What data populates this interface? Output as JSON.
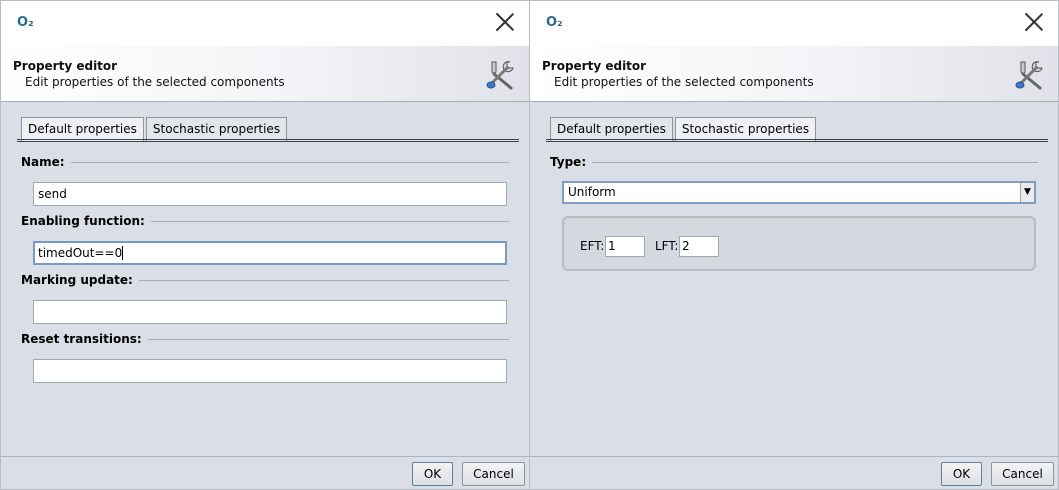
{
  "window": {
    "app_logo": "O₂"
  },
  "header": {
    "title": "Property editor",
    "subtitle": "Edit properties of the selected components",
    "icon": "tools-icon"
  },
  "tabs": [
    "Default properties",
    "Stochastic properties"
  ],
  "left_dialog": {
    "active_tab": "Default properties",
    "fields": [
      {
        "label": "Name:",
        "value": "send"
      },
      {
        "label": "Enabling function:",
        "value": "timedOut==0"
      },
      {
        "label": "Marking update:",
        "value": ""
      },
      {
        "label": "Reset transitions:",
        "value": ""
      }
    ]
  },
  "right_dialog": {
    "active_tab": "Stochastic properties",
    "type_label": "Type:",
    "type_value": "Uniform",
    "eft_label": "EFT:",
    "eft_value": "1",
    "lft_label": "LFT:",
    "lft_value": "2"
  },
  "buttons": {
    "ok": "OK",
    "cancel": "Cancel"
  }
}
